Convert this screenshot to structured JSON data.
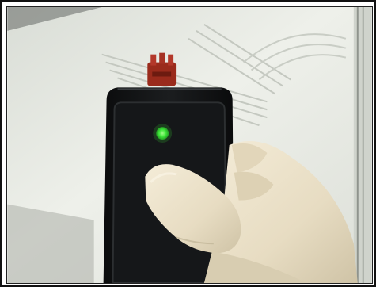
{
  "image": {
    "subject": "hand-held-reader-device",
    "colors": {
      "background": "#e9ece6",
      "device_body": "#141516",
      "led": "#3ee83a",
      "connector": "#9a2b1c",
      "glove": "#efe6cf",
      "frame": "#111111"
    }
  }
}
